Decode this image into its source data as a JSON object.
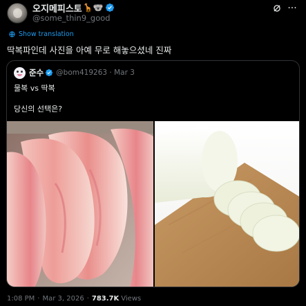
{
  "author": {
    "display_name": "오지메피스토",
    "name_emojis": "🦒🐨",
    "handle": "@some_thin9_good"
  },
  "translate_label": "Show translation",
  "tweet_text": "딱복파인데 사진을 아예 무로 해놓으셨네 진짜",
  "quote": {
    "display_name": "준수",
    "handle": "@bom419263",
    "dot": "·",
    "date": "Mar 3",
    "line1": "물복 vs 딱복",
    "line2": "당신의 선택은?"
  },
  "meta": {
    "time": "1:08 PM",
    "dot1": "·",
    "date": "Mar 3, 2026",
    "dot2": "·",
    "views_count": "783.7K",
    "views_label": "Views"
  },
  "icons": {
    "verified": "verified-badge-icon",
    "grok": "grok-icon",
    "more": "more-icon",
    "translate": "translate-icon"
  },
  "colors": {
    "accent": "#1d9bf0",
    "text": "#e7e9ea",
    "muted": "#71767b",
    "background": "#000000",
    "border": "#2f3336"
  }
}
